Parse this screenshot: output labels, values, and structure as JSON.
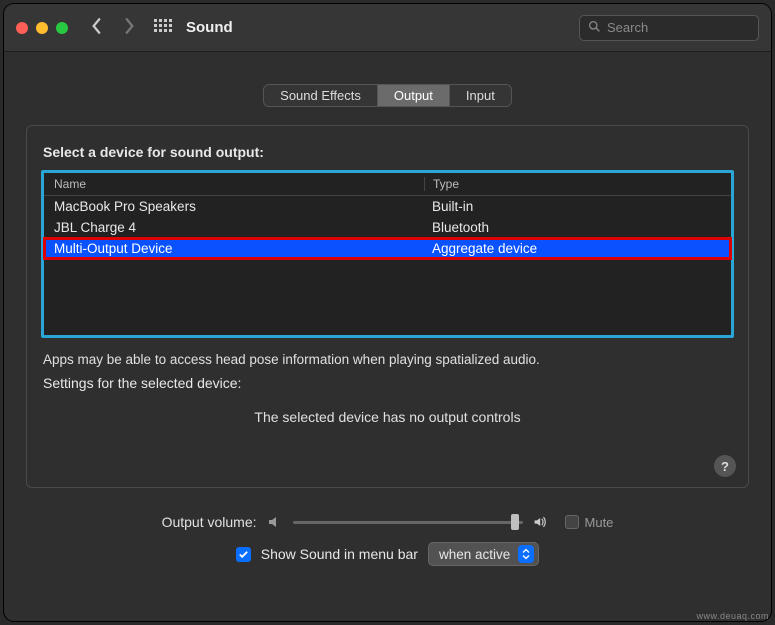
{
  "window": {
    "title": "Sound"
  },
  "search": {
    "placeholder": "Search",
    "value": ""
  },
  "tabs": [
    "Sound Effects",
    "Output",
    "Input"
  ],
  "active_tab": "Output",
  "select_label": "Select a device for sound output:",
  "table": {
    "headers": {
      "name": "Name",
      "type": "Type"
    },
    "rows": [
      {
        "name": "MacBook Pro Speakers",
        "type": "Built-in",
        "selected": false
      },
      {
        "name": "JBL Charge 4",
        "type": "Bluetooth",
        "selected": false
      },
      {
        "name": "Multi-Output Device",
        "type": "Aggregate device",
        "selected": true
      }
    ]
  },
  "notes": {
    "spatial": "Apps may be able to access head pose information when playing spatialized audio.",
    "settings": "Settings for the selected device:",
    "nocontrols": "The selected device has no output controls"
  },
  "help": "?",
  "volume": {
    "label": "Output volume:",
    "value": 95,
    "mute_label": "Mute",
    "mute_checked": false
  },
  "menubar": {
    "checked": true,
    "label": "Show Sound in menu bar",
    "popup": "when active"
  },
  "watermark": "www.deuaq.com"
}
